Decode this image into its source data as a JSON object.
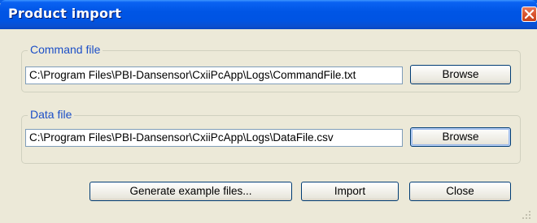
{
  "window": {
    "title": "Product import"
  },
  "command_group": {
    "label": "Command file",
    "path": "C:\\Program Files\\PBI-Dansensor\\CxiiPcApp\\Logs\\CommandFile.txt",
    "browse_label": "Browse"
  },
  "data_group": {
    "label": "Data file",
    "path": "C:\\Program Files\\PBI-Dansensor\\CxiiPcApp\\Logs\\DataFile.csv",
    "browse_label": "Browse"
  },
  "actions": {
    "generate_label": "Generate example files...",
    "import_label": "Import",
    "close_label": "Close"
  },
  "icons": {
    "close": "close-icon",
    "resize": "resize-grip-icon"
  },
  "colors": {
    "title_bar": "#0054e3",
    "group_label": "#1c4fc7",
    "dialog_bg": "#ece9d8",
    "close_button": "#d9552f"
  }
}
